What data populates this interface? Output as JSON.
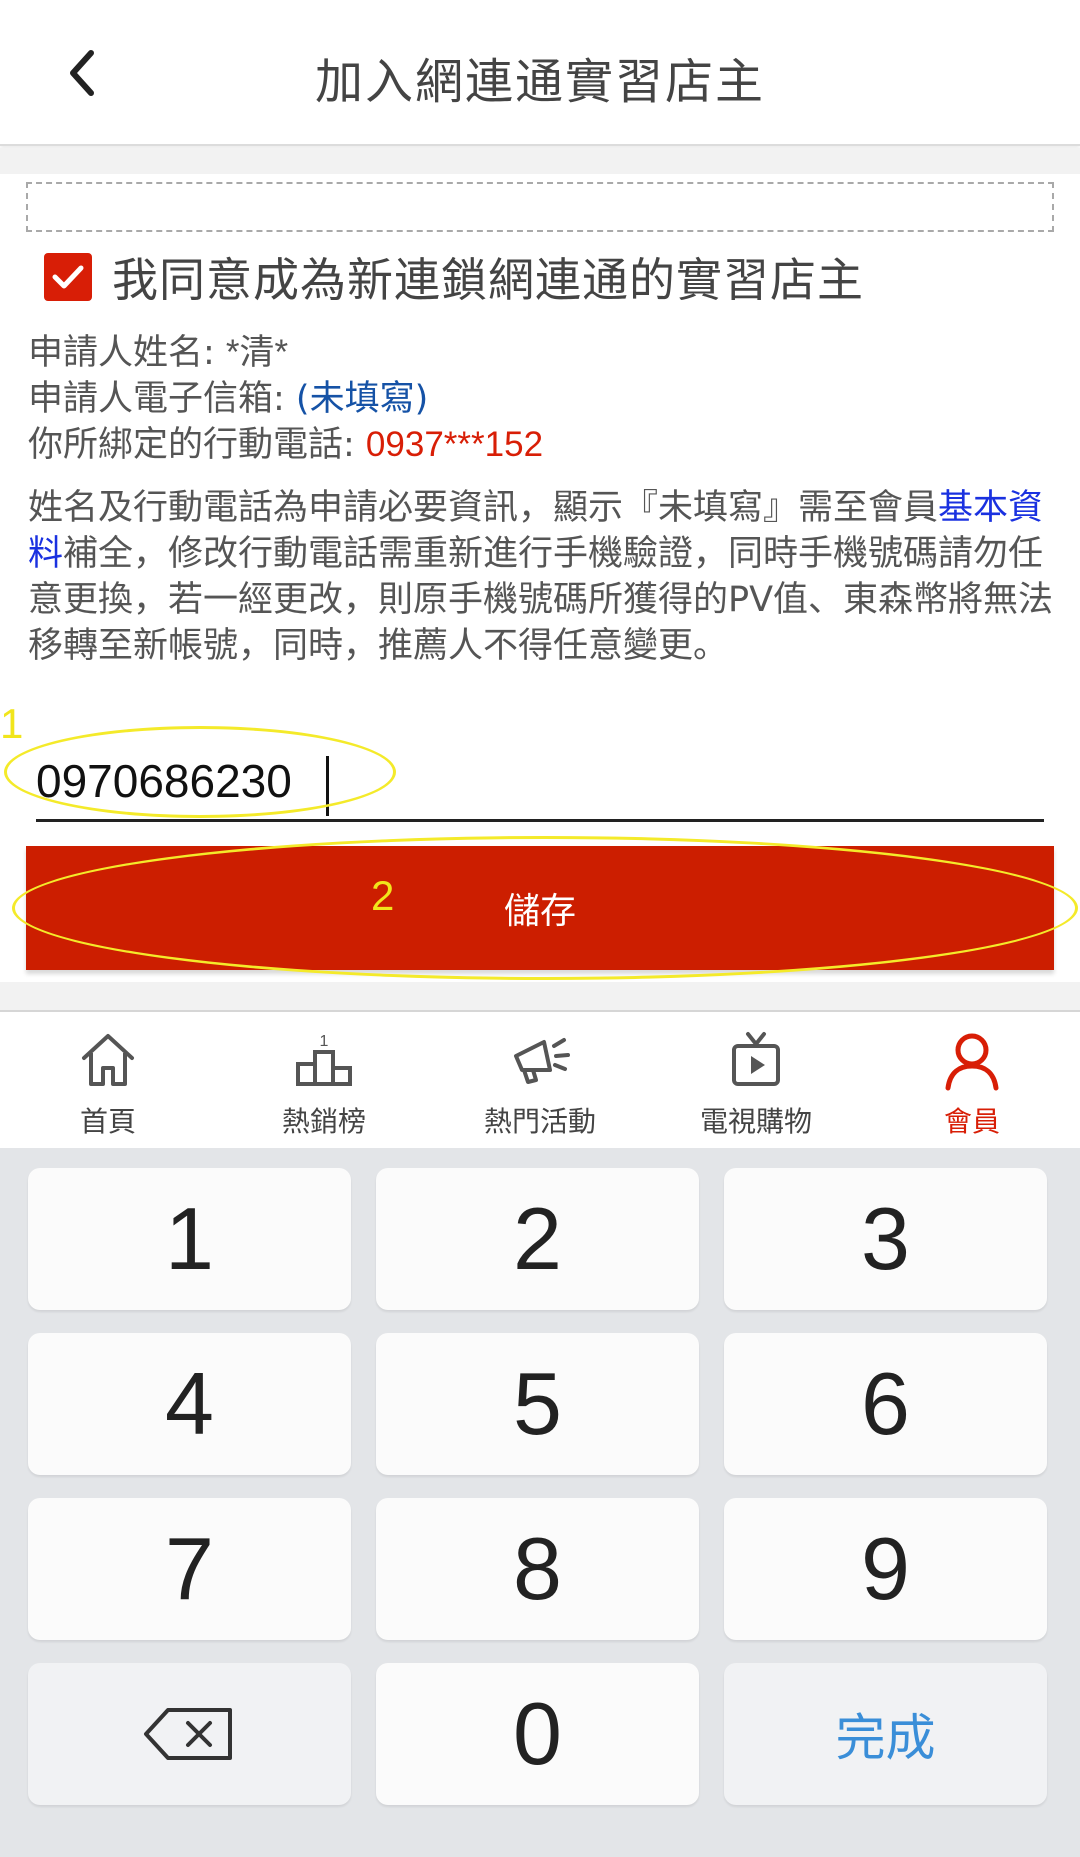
{
  "header": {
    "title": "加入網連通實習店主"
  },
  "form": {
    "agree_label": "我同意成為新連鎖網連通的實習店主",
    "name_label": "申請人姓名: ",
    "name_value": "*清*",
    "email_label": "申請人電子信箱: ",
    "email_value": "(未填寫)",
    "phone_label": "你所綁定的行動電話: ",
    "phone_value": "0937***152",
    "notice_before": "姓名及行動電話為申請必要資訊，顯示『未填寫』需至會員",
    "notice_link": "基本資料",
    "notice_after": "補全，修改行動電話需重新進行手機驗證，同時手機號碼請勿任意更換，若一經更改，則原手機號碼所獲得的PV值、東森幣將無法移轉至新帳號，同時，推薦人不得任意變更。",
    "input_value": "0970686230",
    "save_label": "儲存"
  },
  "annotations": {
    "marker_1": "1",
    "marker_2": "2"
  },
  "nav": {
    "items": [
      {
        "label": "首頁",
        "icon": "home-icon"
      },
      {
        "label": "熱銷榜",
        "icon": "podium-icon"
      },
      {
        "label": "熱門活動",
        "icon": "megaphone-icon"
      },
      {
        "label": "電視購物",
        "icon": "tv-icon"
      },
      {
        "label": "會員",
        "icon": "member-icon",
        "active": true
      }
    ],
    "podium_rank": "1"
  },
  "keyboard": {
    "keys": [
      "1",
      "2",
      "3",
      "4",
      "5",
      "6",
      "7",
      "8",
      "9",
      "0"
    ],
    "done_label": "完成",
    "backspace_icon": "backspace-icon"
  },
  "colors": {
    "accent": "#d81e06",
    "save_button": "#cc1e00",
    "link": "#1a31e0",
    "done": "#3a8ed8",
    "annotation": "#f4ea2a"
  }
}
